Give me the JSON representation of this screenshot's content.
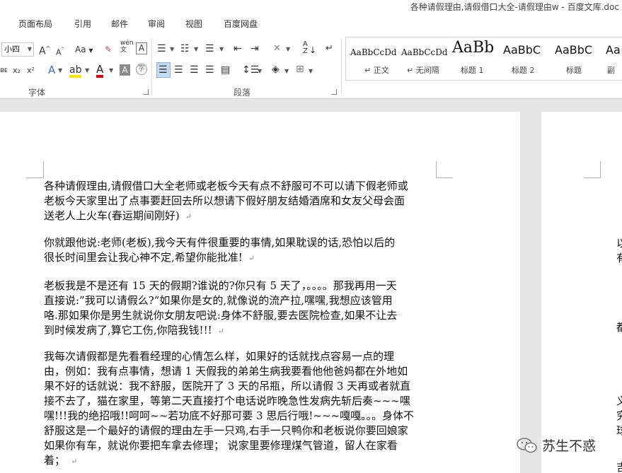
{
  "window": {
    "title": "各种请假理由,请假借口大全-请假理由w - 百度文库.doc"
  },
  "tabs": [
    "页面布局",
    "引用",
    "邮件",
    "审阅",
    "视图",
    "百度网盘"
  ],
  "ribbon": {
    "font_size": "小四",
    "font_label": "字体",
    "paragraph_label": "段落",
    "change_case": "Aa",
    "char_border": "A",
    "grow_font": "A",
    "shrink_font": "A",
    "italic_wave": "ʙᴇ",
    "subscript": "x₂",
    "superscript": "x²",
    "char_shading": "A",
    "phonetic": "wén",
    "sort": "A↓Z",
    "styles": [
      {
        "preview": "AaBbCcDd",
        "name": "↵ 正文"
      },
      {
        "preview": "AaBbCcDd",
        "name": "↵ 无间隔"
      },
      {
        "preview": "AaBb",
        "name": "标题 1"
      },
      {
        "preview": "AaBbC",
        "name": "标题 2"
      },
      {
        "preview": "AaBbC",
        "name": "标题"
      },
      {
        "preview": "Aa",
        "name": "副"
      }
    ]
  },
  "document": {
    "paragraphs": [
      {
        "lines": [
          "各种请假理由,请假借口大全老师或老板今天有点不舒服可不可以请下假老师或",
          "老板今天家里出了点事要赶回去所以想请下假好朋友结婚酒席和女友父母会面",
          "送老人上火车(春运期间刚好)"
        ]
      },
      {
        "lines": [
          "你就跟他说:老师(老板),我今天有件很重要的事情,如果耽误的话,恐怕以后的",
          "很长时间里会让我心神不定,希望你能批准!"
        ]
      },
      {
        "lines": [
          "老板我是不是还有 15 天的假期?谁说的?你只有 5 天了，。。。。那我再用一天",
          "直接说:”我可以请假么?”如果你是女的,就像说的流产拉,嘿嘿,我想应该管用",
          "咯.那如果你是男生就说你女朋友吧说:身体不舒服,要去医院检查,如果不让去",
          "到时候发病了,算它工伤,你陪我钱!!!"
        ]
      },
      {
        "lines": [
          "我每次请假都是先看看经理的心情怎么样，如果好的话就找点容易一点的理",
          "由，例如：我有点事情，想请 1 天假我的弟弟生病我要看他他爸妈都在外地如",
          "果不好的话就说：我不舒服，医院开了 3 天的吊瓶，所以请假 3 天再或者就直",
          "接不去了，猫在家里，等第二天直接打个电话说昨晚急性发病先斩后奏~~~嘿",
          "嘿!!!我的绝招哦!!呵呵~~若功底不好那可要 3 思后行哦!~~~嘎嘎。。。身体不",
          "舒服这是一个最好的请假的理由左手一只鸡,右手一只鸭你和老板说你要回娘家",
          "如果你有车，就说你要把车拿去修理；  说家里要修理煤气管道，留人在家看",
          "着；"
        ]
      }
    ],
    "paragraph_mark": "↵"
  },
  "page2_edge": [
    "以",
    "有",
    "都",
    "义",
    "究",
    "球",
    "吉"
  ],
  "watermark": {
    "text": "苏生不惑"
  }
}
